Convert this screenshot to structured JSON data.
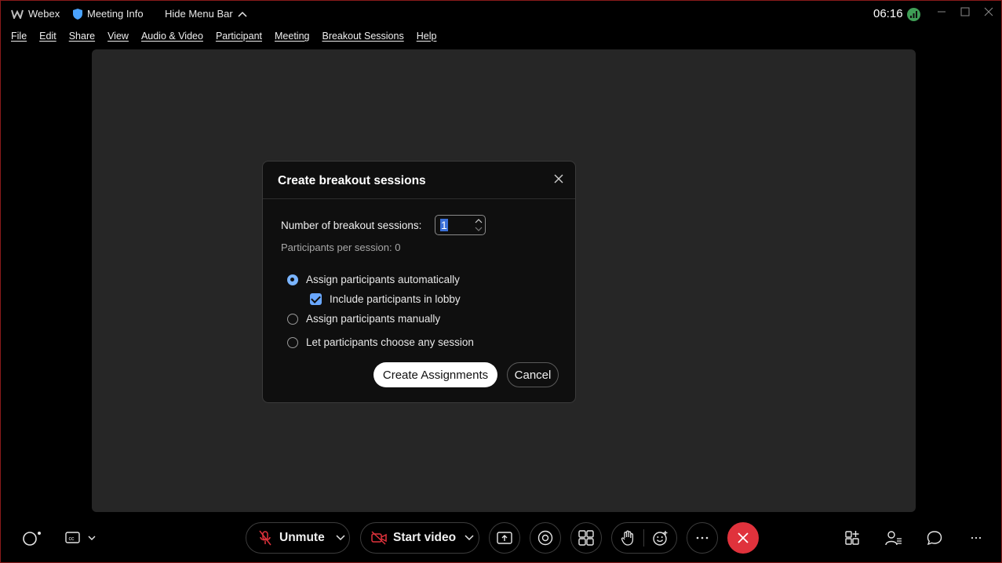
{
  "titlebar": {
    "app_name": "Webex",
    "meeting_info": "Meeting Info",
    "hide_menu_bar": "Hide Menu Bar",
    "clock": "06:16"
  },
  "menu": [
    "File",
    "Edit",
    "Share",
    "View",
    "Audio & Video",
    "Participant",
    "Meeting",
    "Breakout Sessions",
    "Help"
  ],
  "dialog": {
    "title": "Create breakout sessions",
    "number_label": "Number of breakout sessions:",
    "number_value": "1",
    "per_session": "Participants per session: 0",
    "options": {
      "auto": "Assign participants automatically",
      "lobby": "Include participants in lobby",
      "manual": "Assign participants manually",
      "choose": "Let participants choose any session"
    },
    "selected_option": "auto",
    "lobby_checked": true,
    "create_label": "Create Assignments",
    "cancel_label": "Cancel"
  },
  "controls": {
    "unmute_label": "Unmute",
    "video_label": "Start video",
    "end_color": "#e0323c"
  },
  "colors": {
    "accent": "#7ab4ff",
    "stage": "#262626",
    "status_green": "#3f9e56"
  }
}
